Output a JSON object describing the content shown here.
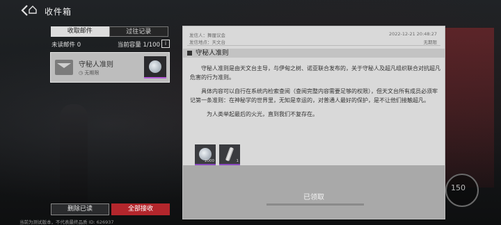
{
  "header": {
    "title": "收件箱"
  },
  "tabs": [
    {
      "label": "收取邮件"
    },
    {
      "label": "过往记录"
    }
  ],
  "inbox_info": {
    "unread": "未读邮件 0",
    "capacity": "当前容量 1/100",
    "info_glyph": "i"
  },
  "mail_list": [
    {
      "title": "守秘人准则",
      "expiry": "无期限",
      "item_icon": "coin-icon"
    }
  ],
  "buttons": {
    "delete_read": "删除已读",
    "receive_all": "全部接收"
  },
  "footer": "当前为测试版本，不代表最终品质 ID: 626937",
  "detail": {
    "sender": "发信人：舞厘议会",
    "location": "发信地点：天文台",
    "time": "2022-12-21 20:48:27",
    "expiry": "无期限",
    "subject": "守秘人准则",
    "paragraphs": [
      "守秘人准则是由天文台主导，与伊甸之树、诺亚联合发布的，关于守秘人及超凡组织联合对抗超凡危害的行为准则。",
      "具体内容可以自行在系统内检索查阅（查阅完整内容需要足够的权限），但天文台所有成员必须牢记第一条准则：在神秘学的世界里，无知是幸运的，对普通人最好的保护，是不让他们接触超凡。",
      "为人类举起最后的火光，直到我们不复存在。"
    ],
    "attachments": [
      {
        "icon": "coin-icon",
        "count": "2000"
      },
      {
        "icon": "vial-icon",
        "count": "1"
      }
    ],
    "status": "已领取"
  },
  "hud": {
    "value": "150"
  },
  "colors": {
    "accent_red": "#b3262c",
    "rarity_purple": "#8b49c0"
  }
}
